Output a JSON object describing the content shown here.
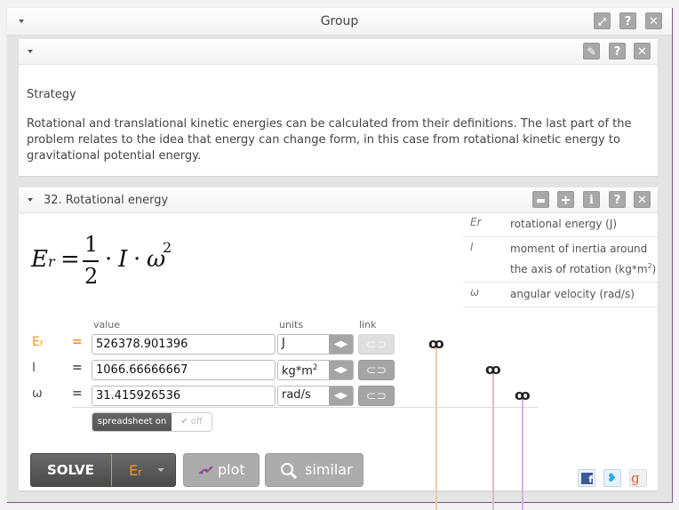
{
  "group": {
    "title": "Group",
    "buttons": {
      "expand_icon": "expand-icon",
      "help": "?",
      "close": "✕"
    }
  },
  "strategy_panel": {
    "buttons": {
      "edit_icon": "pencil-icon",
      "help": "?",
      "close": "✕"
    },
    "title": "Strategy",
    "text": "Rotational and translational kinetic energies can be calculated from their definitions. The last part of the problem relates to the idea that energy can change form, in this case from rotational kinetic energy to gravitational potential energy."
  },
  "equation_panel": {
    "title": "32. Rotational energy",
    "buttons": {
      "comment": "comment-icon",
      "add": "+",
      "info": "i",
      "help": "?",
      "close": "✕"
    },
    "formula": {
      "lhs": "E",
      "lhs_sub": "r",
      "equals": "=",
      "num": "1",
      "den": "2",
      "dot": "·",
      "I": "I",
      "omega": "ω",
      "exp": "2"
    },
    "variables": [
      {
        "symbol": "Er",
        "description": "rotational energy (J)"
      },
      {
        "symbol": "I",
        "description_main": "moment of inertia around the axis of rotation (kg*m",
        "description_sup": "2",
        "description_end": ")"
      },
      {
        "symbol": "ω",
        "description": "angular velocity (rad/s)"
      }
    ],
    "columns": {
      "value": "value",
      "units": "units",
      "link": "link"
    },
    "rows": [
      {
        "label": "E",
        "label_sub": "r",
        "eq": "=",
        "value": "526378.901396",
        "unit": "J",
        "unit_sup": "",
        "link_enabled": false
      },
      {
        "label": "I",
        "label_sub": "",
        "eq": "=",
        "value": "1066.66666667",
        "unit": "kg*m",
        "unit_sup": "2",
        "link_enabled": true
      },
      {
        "label": "ω",
        "label_sub": "",
        "eq": "=",
        "value": "31.415926536",
        "unit": "rad/s",
        "unit_sup": "",
        "link_enabled": true
      }
    ],
    "spreadsheet": {
      "on_label": "spreadsheet on",
      "off_label": "✔ off",
      "state": "on"
    },
    "actions": {
      "solve": "SOLVE",
      "solve_for": "E",
      "solve_for_sub": "r",
      "plot": "plot",
      "similar": "similar"
    },
    "social": [
      "facebook",
      "twitter",
      "google-plus"
    ],
    "colors": {
      "accent": "#f7931e",
      "line_er": "#f3c9a4",
      "line_i": "#d3c3c6",
      "line_w": "#d6b0f0"
    }
  }
}
